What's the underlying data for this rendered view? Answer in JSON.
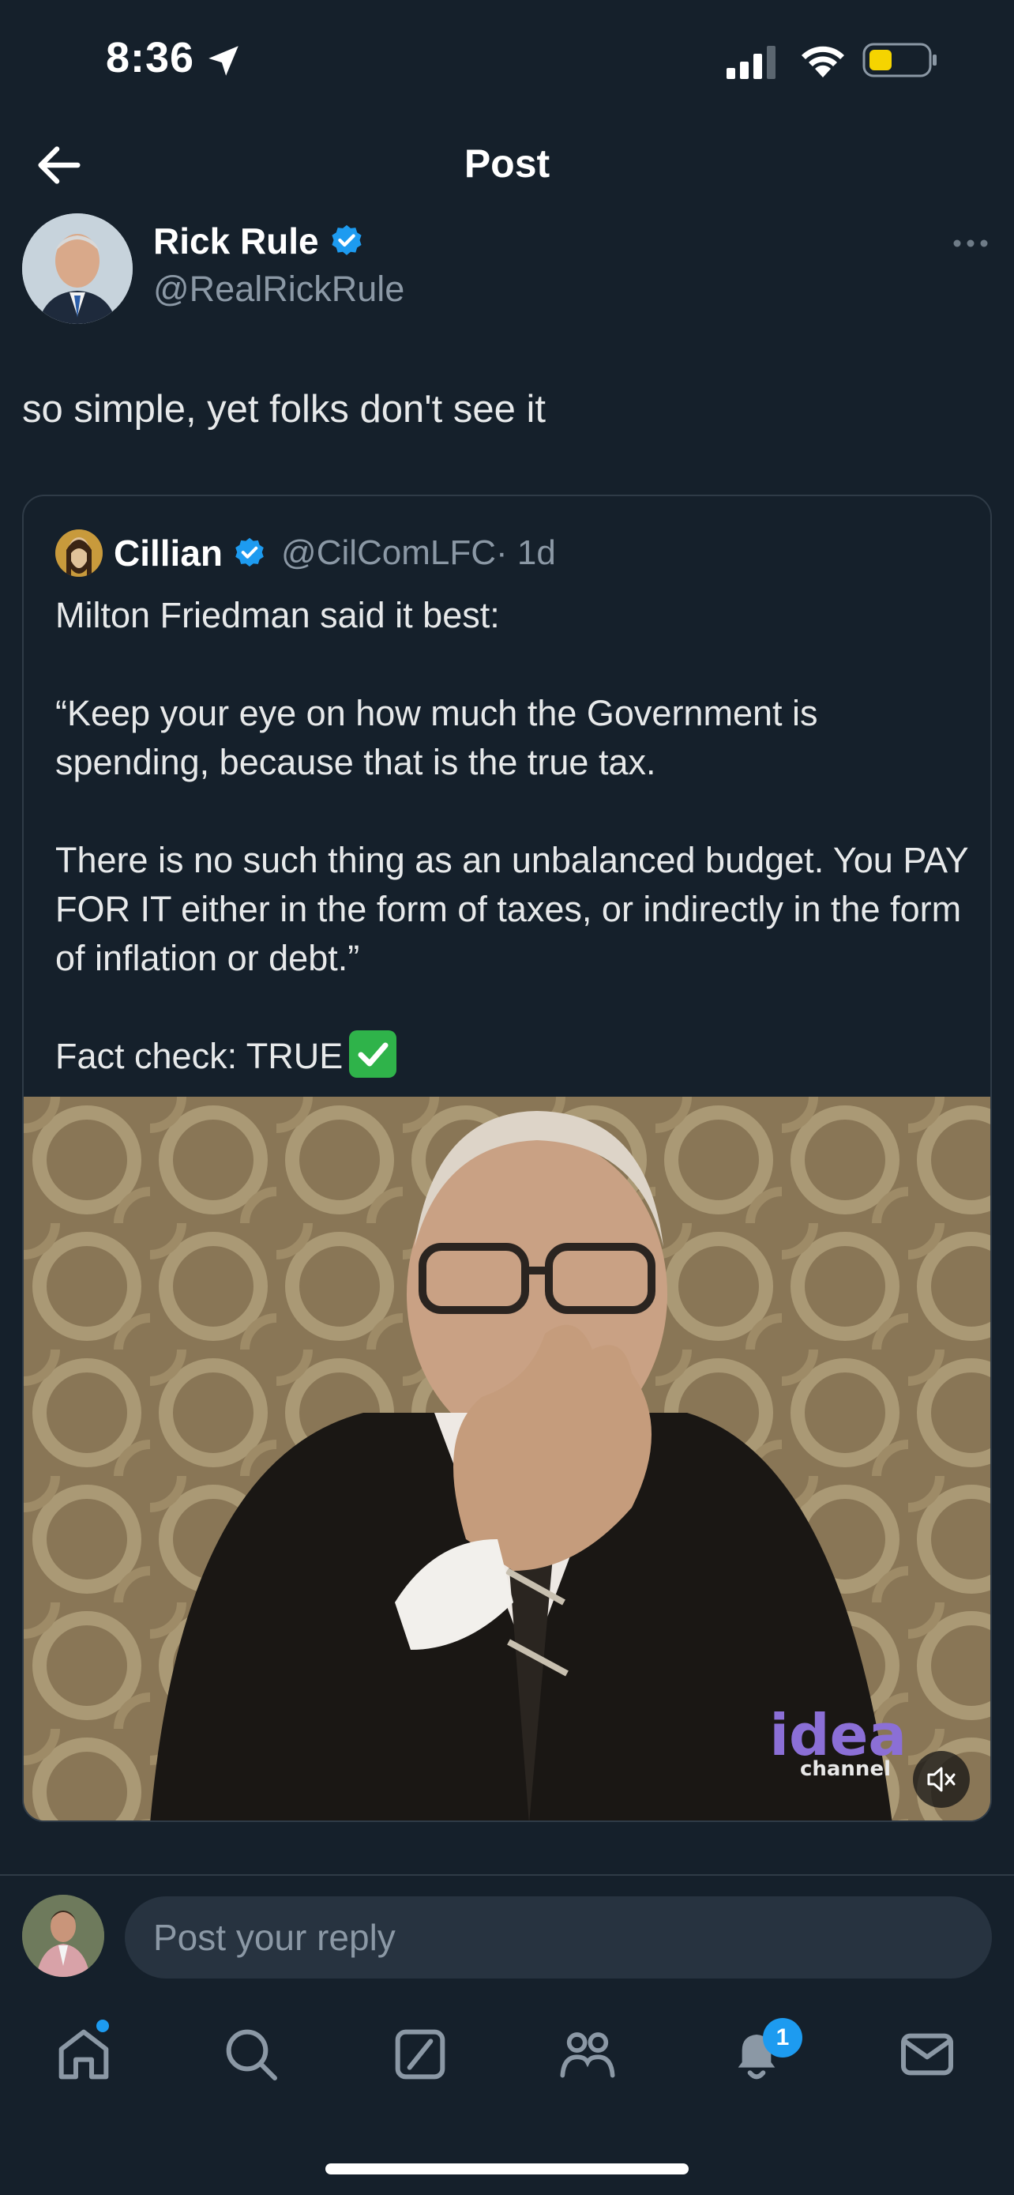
{
  "status_bar": {
    "time": "8:36"
  },
  "header": {
    "title": "Post"
  },
  "post": {
    "author_name": "Rick Rule",
    "author_handle": "@RealRickRule",
    "text": "so simple, yet folks don't see it"
  },
  "quote": {
    "author_name": "Cillian",
    "author_handle": "@CilComLFC",
    "time": "· 1d",
    "paragraphs": [
      "Milton Friedman said it best:",
      "“Keep your eye on how much the Government is spending, because that is the true tax.",
      "There is no such thing as an unbalanced budget. You PAY FOR IT either in the form of taxes, or indirectly in the form of inflation or debt.”",
      "Fact check: TRUE"
    ],
    "video_watermark": "idea",
    "video_watermark_sub": "channel"
  },
  "reply": {
    "placeholder": "Post your reply"
  },
  "tab_bar": {
    "notifications_badge": "1"
  },
  "colors": {
    "background": "#15202b",
    "accent": "#1d9bf0",
    "muted": "#8b98a5"
  }
}
